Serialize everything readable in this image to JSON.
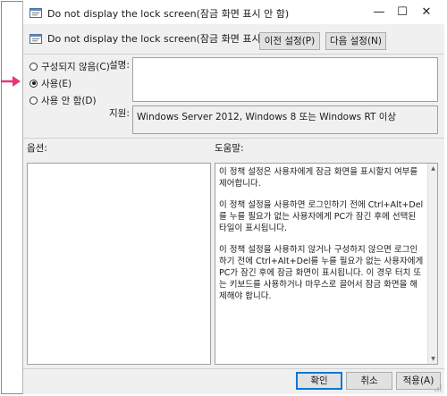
{
  "window": {
    "title": "Do not display the lock screen(잠금 화면 표시 안 함)",
    "minimize_glyph": "—",
    "maximize_glyph": "☐",
    "close_glyph": "✕"
  },
  "header": {
    "setting_name": "Do not display the lock screen(잠금 화면 표시 안 함)",
    "prev_button": "이전 설정(P)",
    "next_button": "다음 설정(N)"
  },
  "state_options": [
    {
      "label": "구성되지 않음(C)",
      "checked": false
    },
    {
      "label": "사용(E)",
      "checked": true
    },
    {
      "label": "사용 안 함(D)",
      "checked": false
    }
  ],
  "comment": {
    "label": "설명:",
    "value": ""
  },
  "supported": {
    "label": "지원:",
    "value": "Windows Server 2012, Windows 8 또는 Windows RT 이상"
  },
  "options_panel": {
    "label": "옵션:"
  },
  "help_panel": {
    "label": "도움말:",
    "paragraphs": [
      "이 정책 설정은 사용자에게 잠금 화면을 표시할지 여부를 제어합니다.",
      "이 정책 설정을 사용하면 로그인하기 전에 Ctrl+Alt+Del를 누를 필요가 없는 사용자에게 PC가 잠긴 후에 선택된 타일이 표시됩니다.",
      "이 정책 설정을 사용하지 않거나 구성하지 않으면 로그인하기 전에 Ctrl+Alt+Del를 누를 필요가 없는 사용자에게 PC가 잠긴 후에 잠금 화면이 표시됩니다. 이 경우 터치 또는 키보드를 사용하거나 마우스로 끌어서 잠금 화면을 해제해야 합니다."
    ]
  },
  "footer": {
    "ok_button": "확인",
    "cancel_button": "취소",
    "apply_button": "적용(A)"
  },
  "colors": {
    "arrow": "#e8357a",
    "accent": "#0078d7"
  }
}
